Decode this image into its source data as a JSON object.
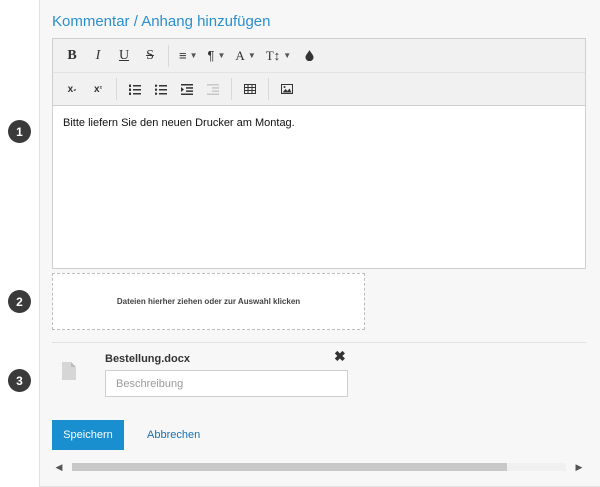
{
  "title": "Kommentar / Anhang hinzufügen",
  "toolbar": {
    "row1": [
      {
        "name": "bold-button",
        "label": "B",
        "cls": "bold"
      },
      {
        "name": "italic-button",
        "label": "I",
        "cls": "italic"
      },
      {
        "name": "underline-button",
        "label": "U",
        "cls": "under"
      },
      {
        "name": "strikethrough-button",
        "label": "S",
        "cls": "strike"
      }
    ],
    "paragraph_label": "¶",
    "font_label": "A",
    "size_label": "T↕",
    "align_label": "≡",
    "color_icon": "🌢"
  },
  "editor": {
    "content": "Bitte liefern Sie den neuen Drucker am Montag."
  },
  "dropzone": {
    "text": "Dateien hierher ziehen oder zur Auswahl klicken"
  },
  "attachment": {
    "filename": "Bestellung.docx",
    "description_placeholder": "Beschreibung",
    "description_value": ""
  },
  "actions": {
    "save_label": "Speichern",
    "cancel_label": "Abbrechen"
  },
  "badges": [
    "1",
    "2",
    "3"
  ],
  "colors": {
    "accent": "#1a8fd0",
    "title": "#2a8fd0",
    "badge": "#3a3a3a"
  }
}
